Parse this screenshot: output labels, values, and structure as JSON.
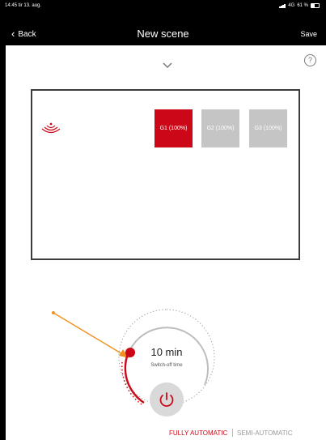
{
  "status_bar": {
    "time": "14:45",
    "date": "tir 13. aug.",
    "network": "4G",
    "battery": "61 %"
  },
  "nav": {
    "back_label": "Back",
    "title": "New scene",
    "save_label": "Save"
  },
  "help": {
    "label": "?"
  },
  "groups": [
    {
      "label": "G1 (100%)",
      "active": true
    },
    {
      "label": "G2 (100%)",
      "active": false
    },
    {
      "label": "G3 (100%)",
      "active": false
    }
  ],
  "timer": {
    "value": "10 min",
    "label": "Switch-off time"
  },
  "modes": {
    "fully_automatic": "FULLY AUTOMATIC",
    "semi_automatic": "SEMI-AUTOMATIC",
    "selected": "fully_automatic"
  },
  "colors": {
    "accent": "#cc0818",
    "inactive_tile": "#c5c5c5",
    "annotation_arrow": "#f0901f",
    "background": "#000000"
  },
  "icons": [
    "chevron-left-icon",
    "chevron-down-icon",
    "help-icon",
    "sensor-icon",
    "power-icon",
    "signal-icon",
    "battery-icon"
  ]
}
